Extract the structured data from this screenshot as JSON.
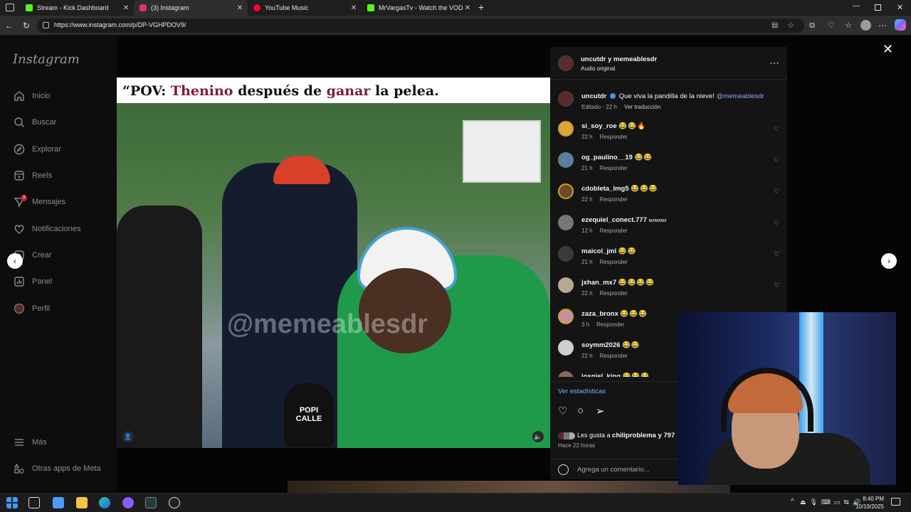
{
  "browser": {
    "tabs": [
      {
        "label": "Stream - Kick Dashboard",
        "icon": "kick-icon",
        "color": "#53fc18",
        "active": false
      },
      {
        "label": "(3) Instagram",
        "icon": "instagram-icon",
        "color": "#e1306c",
        "active": true
      },
      {
        "label": "YouTube Music",
        "icon": "youtube-music-icon",
        "color": "#ff0033",
        "active": false
      },
      {
        "label": "MrVargasTv - Watch the VOD on",
        "icon": "kick-icon",
        "color": "#53fc18",
        "active": false
      }
    ],
    "url": "https://www.instagram.com/p/DP-VGHPDOV9/"
  },
  "sidebar": {
    "logo": "Instagram",
    "items": [
      {
        "label": "Inicio",
        "icon": "home-icon"
      },
      {
        "label": "Buscar",
        "icon": "search-icon"
      },
      {
        "label": "Explorar",
        "icon": "compass-icon"
      },
      {
        "label": "Reels",
        "icon": "reels-icon"
      },
      {
        "label": "Mensajes",
        "icon": "messages-icon"
      },
      {
        "label": "Notificaciones",
        "icon": "heart-icon"
      },
      {
        "label": "Crear",
        "icon": "plus-icon"
      },
      {
        "label": "Panel",
        "icon": "panel-icon"
      },
      {
        "label": "Perfil",
        "icon": "profile-icon"
      }
    ],
    "bottom_items": [
      {
        "label": "Más",
        "icon": "menu-icon"
      },
      {
        "label": "Otras apps de Meta",
        "icon": "meta-apps-icon"
      }
    ],
    "messages_badge": "3"
  },
  "video": {
    "caption_parts": [
      "“POV: ",
      "Thenino",
      " después de ",
      "ganar",
      " la pelea."
    ],
    "watermark": "@memeablesdr",
    "mic_text": "POPI CALLE"
  },
  "post": {
    "header_user": "uncutdr y memeablesdr",
    "header_audio": "Audio original",
    "author": "uncutdr",
    "caption": "Que viva la pandilla de la nieve!",
    "mention": "@memeablesdr",
    "meta_time": "Editado · 22 h",
    "translate": "Ver traducción",
    "comments": [
      {
        "user": "si_soy_roe",
        "text": "😂😂🔥",
        "time": "22 h",
        "reply": "Responder",
        "color": "#e0a33a"
      },
      {
        "user": "og_paulino__19",
        "text": "😂😂",
        "time": "21 h",
        "reply": "Responder",
        "color": "#5d7da0"
      },
      {
        "user": "cdobleta_lmg5",
        "text": "😂😂😂",
        "time": "22 h",
        "reply": "Responder",
        "color": "#6a4a2a"
      },
      {
        "user": "ezequiel_conect.777",
        "text": "ᴍxᴍxᴍx",
        "time": "12 h",
        "reply": "Responder",
        "color": "#777777"
      },
      {
        "user": "maicol_jml",
        "text": "😂😂",
        "time": "21 h",
        "reply": "Responder",
        "color": "#3a3a3a"
      },
      {
        "user": "jxhan_mx7",
        "text": "😂😂😂😂",
        "time": "22 h",
        "reply": "Responder",
        "color": "#b8a890"
      },
      {
        "user": "zaza_bronx",
        "text": "😂😂😂",
        "time": "3 h",
        "reply": "Responder",
        "color": "#c98ea0"
      },
      {
        "user": "soymm2026",
        "text": "😂😂",
        "time": "22 h",
        "reply": "Responder",
        "color": "#cfcfcf"
      },
      {
        "user": "josniel_king",
        "text": "😂😂😂",
        "time": "",
        "reply": "",
        "color": "#8a6a5a"
      }
    ],
    "stats_link": "Ver estadísticas",
    "likes_prefix": "Les gusta a ",
    "likes_user": "chiliproblema",
    "likes_suffix": " y 797",
    "posted": "Hace 22 horas",
    "comment_placeholder": "Agrega un comentario..."
  },
  "taskbar": {
    "time": "8:40 PM",
    "date": "10/19/2025"
  }
}
